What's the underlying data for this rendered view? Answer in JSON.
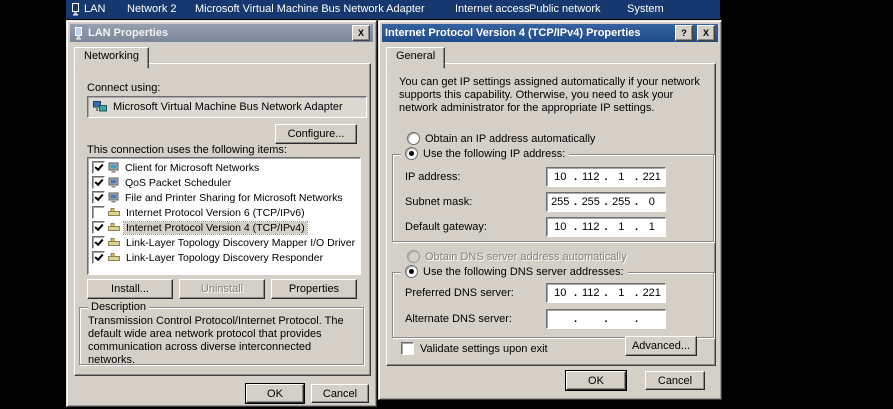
{
  "ui": {
    "dot": "."
  },
  "colors": {
    "taskbar_blue": "#17386e",
    "active_title_blue": "#2b5aa0",
    "dialog_gray": "#d4d0c8"
  },
  "topbar": {
    "items": [
      {
        "label": "LAN"
      },
      {
        "label": "Network 2"
      },
      {
        "label": "Microsoft Virtual Machine Bus Network Adapter"
      },
      {
        "label": "Internet access"
      },
      {
        "label": "Public network"
      },
      {
        "label": "System"
      }
    ]
  },
  "lan_dialog": {
    "title": "LAN Properties",
    "close_label": "X",
    "tab": "Networking",
    "connect_using_label": "Connect using:",
    "adapter_name": "Microsoft Virtual Machine Bus Network Adapter",
    "configure_button": "Configure...",
    "items_caption": "This connection uses the following items:",
    "items": [
      {
        "checked": true,
        "label": "Client for Microsoft Networks",
        "selected": false
      },
      {
        "checked": true,
        "label": "QoS Packet Scheduler",
        "selected": false
      },
      {
        "checked": true,
        "label": "File and Printer Sharing for Microsoft Networks",
        "selected": false
      },
      {
        "checked": false,
        "label": "Internet Protocol Version 6 (TCP/IPv6)",
        "selected": false
      },
      {
        "checked": true,
        "label": "Internet Protocol Version 4 (TCP/IPv4)",
        "selected": true
      },
      {
        "checked": true,
        "label": "Link-Layer Topology Discovery Mapper I/O Driver",
        "selected": false
      },
      {
        "checked": true,
        "label": "Link-Layer Topology Discovery Responder",
        "selected": false
      }
    ],
    "install_button": "Install...",
    "uninstall_button": "Uninstall",
    "uninstall_disabled": true,
    "properties_button": "Properties",
    "description_caption": "Description",
    "description_text": "Transmission Control Protocol/Internet Protocol. The default wide area network protocol that provides communication across diverse interconnected networks.",
    "ok_button": "OK",
    "cancel_button": "Cancel"
  },
  "ipv4_dialog": {
    "title": "Internet Protocol Version 4 (TCP/IPv4) Properties",
    "help_label": "?",
    "close_label": "X",
    "tab": "General",
    "intro_text": "You can get IP settings assigned automatically if your network supports this capability. Otherwise, you need to ask your network administrator for the appropriate IP settings.",
    "obtain_ip": {
      "label": "Obtain an IP address automatically",
      "selected": false
    },
    "use_ip": {
      "label": "Use the following IP address:",
      "selected": true
    },
    "ip_address": {
      "label": "IP address:",
      "octets": [
        "10",
        "112",
        "1",
        "221"
      ]
    },
    "subnet_mask": {
      "label": "Subnet mask:",
      "octets": [
        "255",
        "255",
        "255",
        "0"
      ]
    },
    "default_gateway": {
      "label": "Default gateway:",
      "octets": [
        "10",
        "112",
        "1",
        "1"
      ]
    },
    "obtain_dns": {
      "label": "Obtain DNS server address automatically",
      "selected": false,
      "disabled": true
    },
    "use_dns": {
      "label": "Use the following DNS server addresses:",
      "selected": true
    },
    "preferred_dns": {
      "label": "Preferred DNS server:",
      "octets": [
        "10",
        "112",
        "1",
        "221"
      ]
    },
    "alternate_dns": {
      "label": "Alternate DNS server:",
      "octets": [
        "",
        "",
        "",
        ""
      ]
    },
    "validate_checkbox": {
      "label": "Validate settings upon exit",
      "checked": false
    },
    "advanced_button": "Advanced...",
    "ok_button": "OK",
    "cancel_button": "Cancel"
  }
}
